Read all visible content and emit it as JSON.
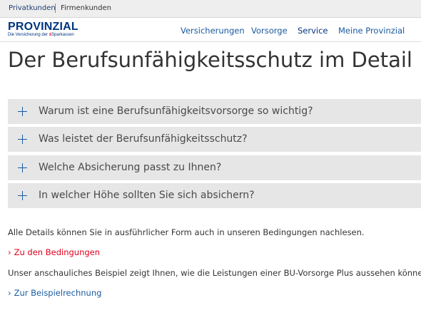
{
  "topbar": {
    "items": [
      {
        "label": "Privatkunden"
      },
      {
        "label": "Firmenkunden"
      }
    ]
  },
  "brand": {
    "name": "PROVINZIAL",
    "tagline": "Die Versicherung der",
    "tagline_brand": "Sparkassen",
    "color": "#00357f"
  },
  "nav": {
    "items": [
      {
        "label": "Versicherungen"
      },
      {
        "label": "Vorsorge"
      },
      {
        "label": "Service"
      },
      {
        "label": "Meine Provinzial"
      }
    ]
  },
  "page": {
    "title": "Der Berufsunfähigkeitsschutz im Detail"
  },
  "accordion": {
    "items": [
      {
        "label": "Warum ist eine Berufsunfähigkeitsvorsorge so wichtig?",
        "icon": "plus-icon"
      },
      {
        "label": "Was leistet der Berufsunfähigkeitsschutz?",
        "icon": "plus-icon"
      },
      {
        "label": "Welche Absicherung passt zu Ihnen?",
        "icon": "plus-icon"
      },
      {
        "label": "In welcher Höhe sollten Sie sich absichern?",
        "icon": "plus-icon"
      }
    ]
  },
  "content": {
    "details_text": "Alle Details können Sie in ausführlicher Form auch in unseren Bedingungen nachlesen.",
    "conditions_link": "Zu den Bedingungen",
    "example_text": "Unser anschauliches Beispiel zeigt Ihnen, wie die Leistungen einer BU-Vorsorge Plus aussehen können.",
    "example_link": "Zur Beispielrechnung",
    "chevron": "›"
  },
  "colors": {
    "accent_red": "#e2001a",
    "link_blue": "#1a5aa0",
    "accordion_bg": "#e6e6e6"
  }
}
